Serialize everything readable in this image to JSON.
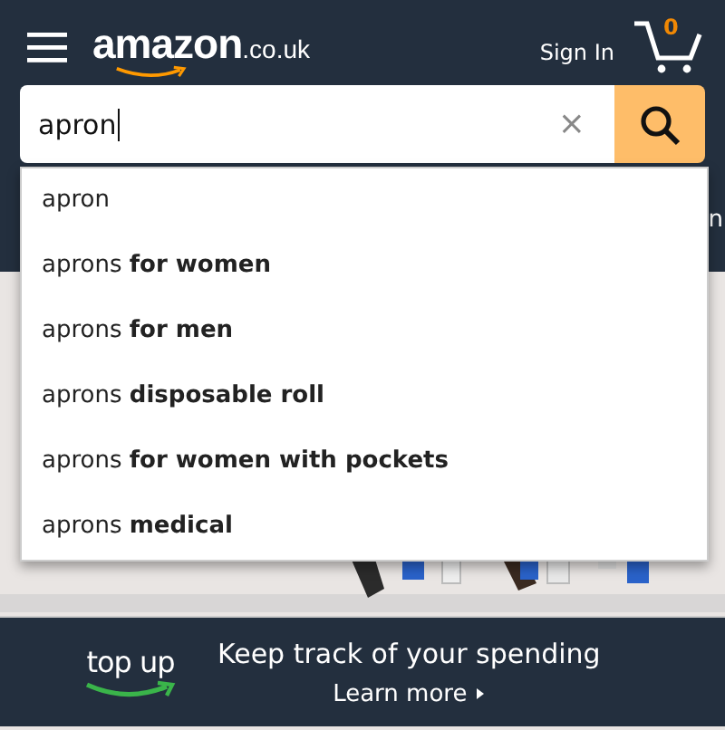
{
  "header": {
    "logo": "amazon",
    "logo_suffix": ".co.uk",
    "sign_in": "Sign In",
    "cart_count": "0"
  },
  "search": {
    "value": "apron",
    "clear": "×"
  },
  "nav": {
    "partial_text": "n"
  },
  "suggestions": [
    {
      "text": "apron"
    },
    {
      "text": "aprons **for women**"
    },
    {
      "text": "aprons **for men**"
    },
    {
      "text": "aprons **disposable roll**"
    },
    {
      "text": "aprons **for women with pockets**"
    },
    {
      "text": "aprons **medical**"
    }
  ],
  "banner": {
    "logo": "top up",
    "headline": "Keep track of your spending",
    "link": "Learn more"
  }
}
